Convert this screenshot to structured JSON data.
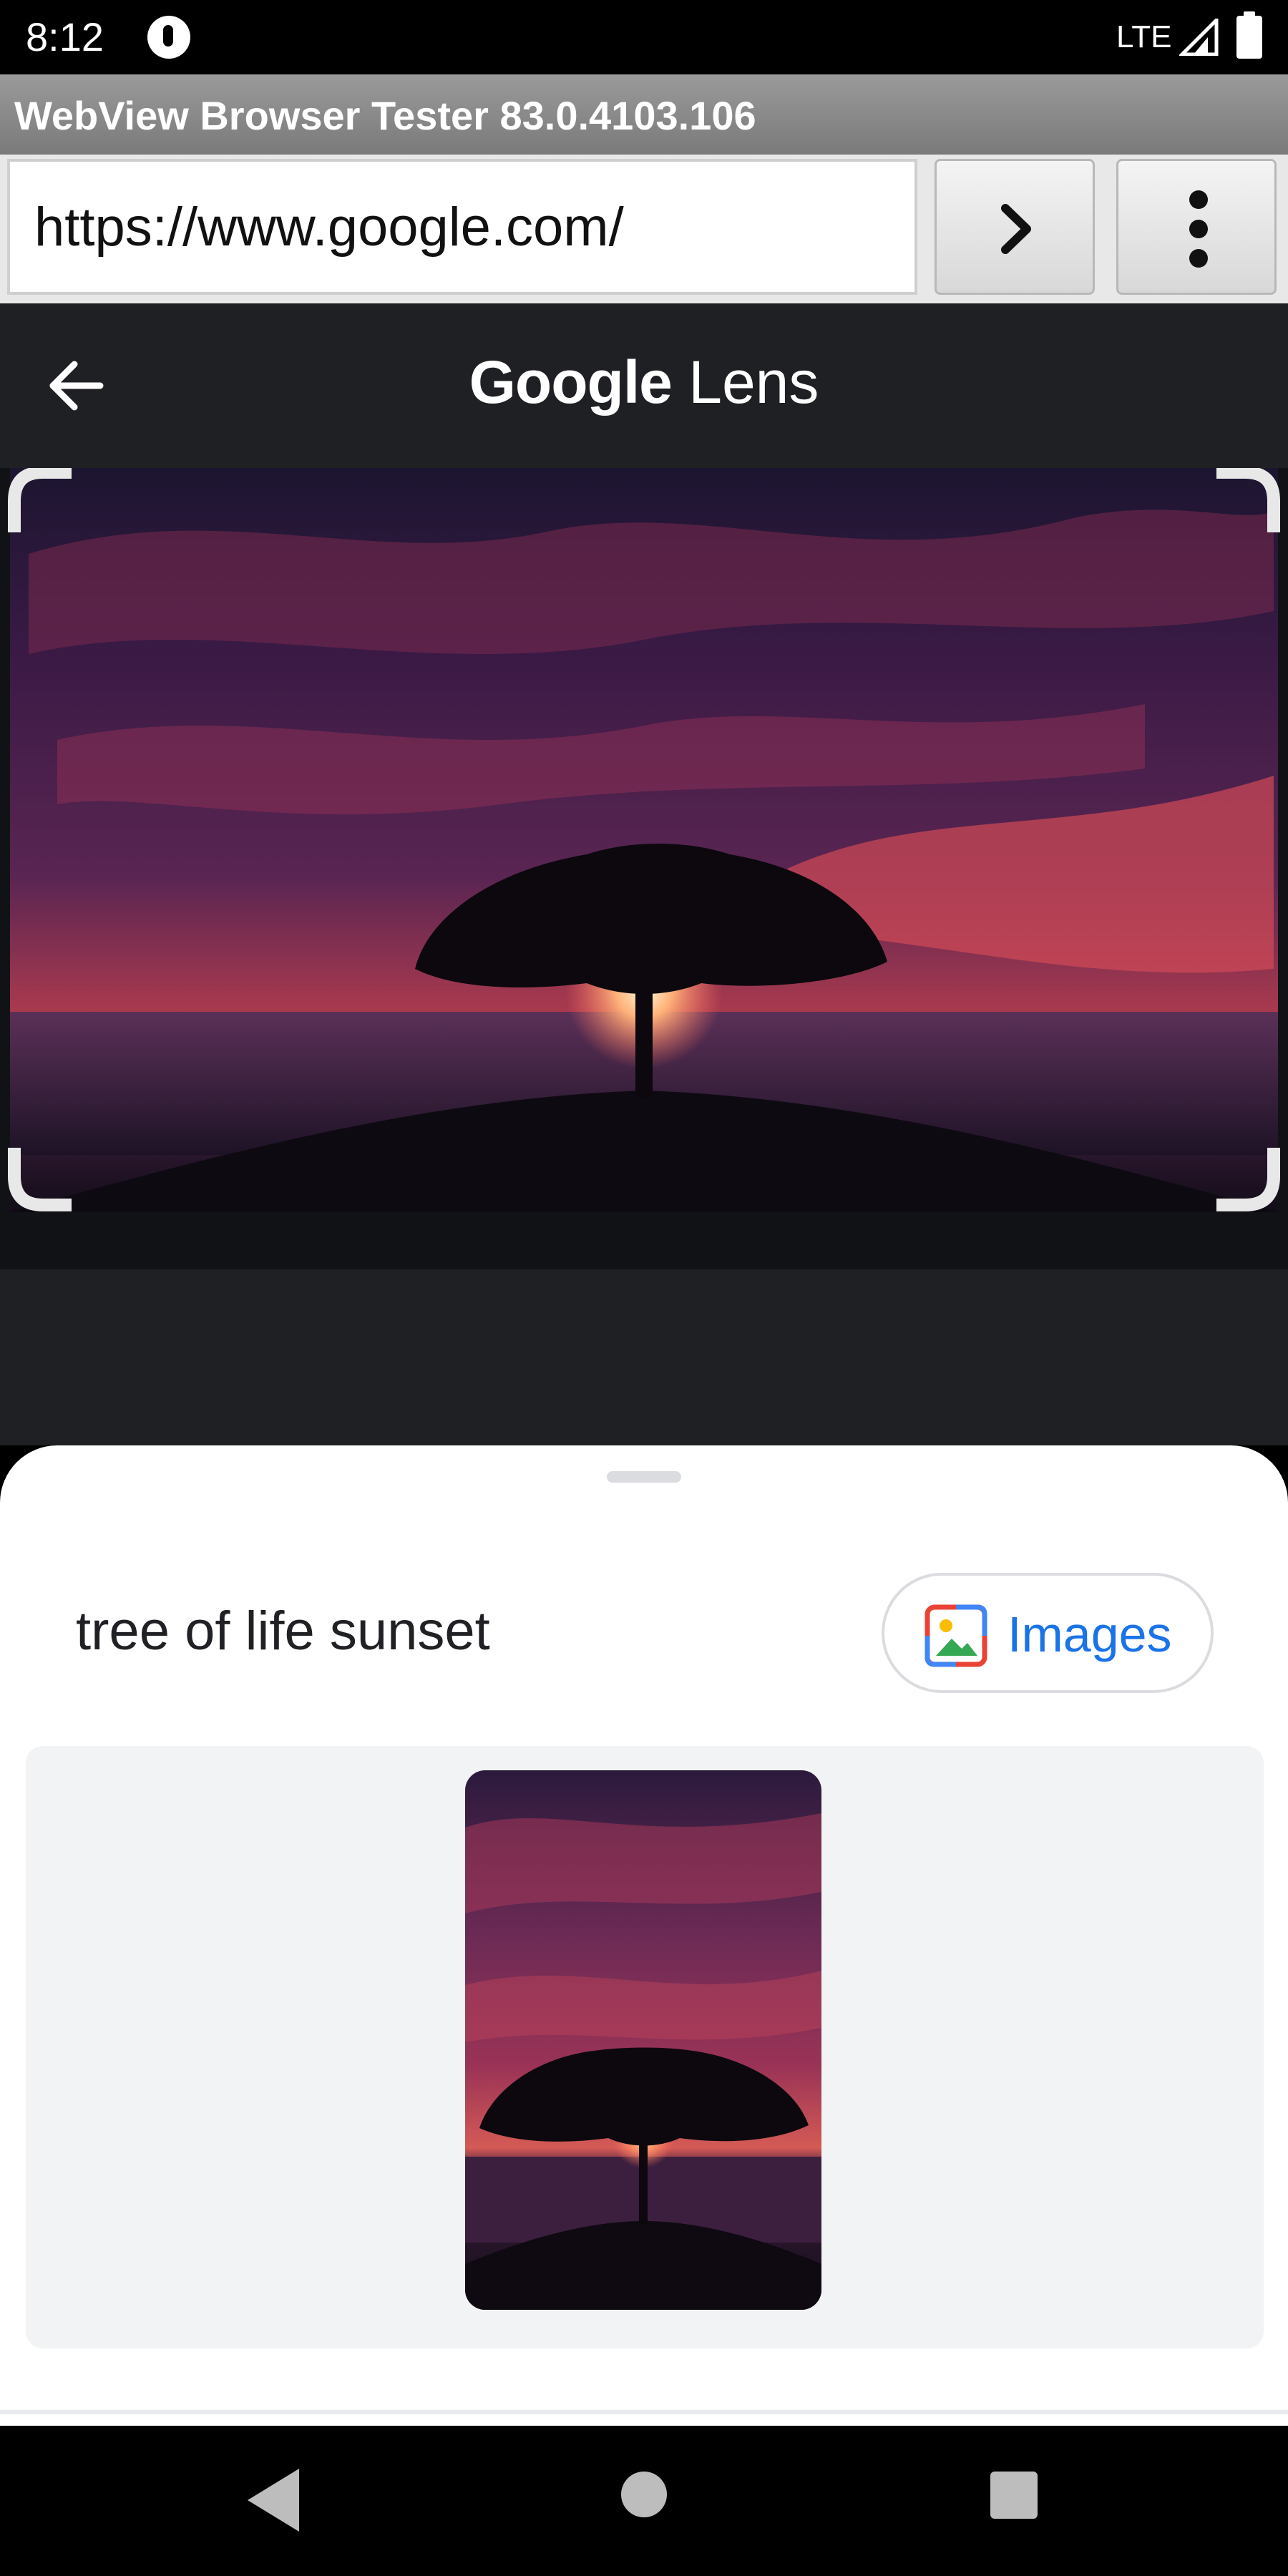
{
  "status_bar": {
    "time": "8:12",
    "network": "LTE"
  },
  "app": {
    "title": "WebView Browser Tester 83.0.4103.106"
  },
  "url_bar": {
    "url": "https://www.google.com/",
    "go_icon": "chevron-right-icon",
    "menu_icon": "more-vertical-icon"
  },
  "lens": {
    "title_brand": "Google",
    "title_product": "Lens",
    "back_icon": "arrow-left-icon",
    "image_description_icon": "sunset-tree-photo"
  },
  "results": {
    "query": "tree of life sunset",
    "chip_label": "Images",
    "chip_icon": "image-icon"
  },
  "nav": {
    "back_icon": "triangle-back-icon",
    "home_icon": "circle-home-icon",
    "recents_icon": "square-recents-icon"
  },
  "colors": {
    "lens_bg": "#1f2023",
    "link_blue": "#1a73e8",
    "card_bg": "#f1f3f4"
  }
}
